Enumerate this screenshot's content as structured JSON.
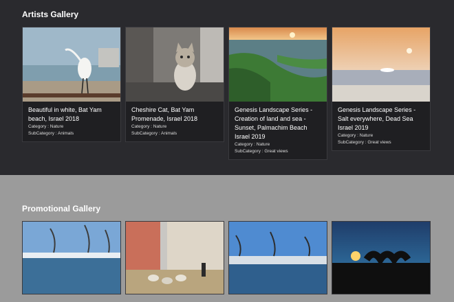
{
  "sections": {
    "artists_title": "Artists Gallery",
    "promo_title": "Promotional Gallery"
  },
  "artists": [
    {
      "caption": "Beautiful in white, Bat Yam beach, Israel 2018",
      "category": "Category : Nature",
      "subcategory": "SubCategory : Animals"
    },
    {
      "caption": "Cheshire Cat, Bat Yam Promenade, Israel 2018",
      "category": "Category : Nature",
      "subcategory": "SubCategory : Animals"
    },
    {
      "caption": "Genesis Landscape Series - Creation of land and sea - Sunset, Palmachim Beach Israel 2019",
      "category": "Category : Nature",
      "subcategory": "SubCategory : Great views"
    },
    {
      "caption": "Genesis Landscape Series - Salt everywhere, Dead Sea Israel 2019",
      "category": "Category : Nature",
      "subcategory": "SubCategory : Great views"
    }
  ],
  "colors": {
    "dark_bg": "#2a2a2e",
    "gray_bg": "#9b9b9b",
    "card_bg": "#1f1f22"
  }
}
